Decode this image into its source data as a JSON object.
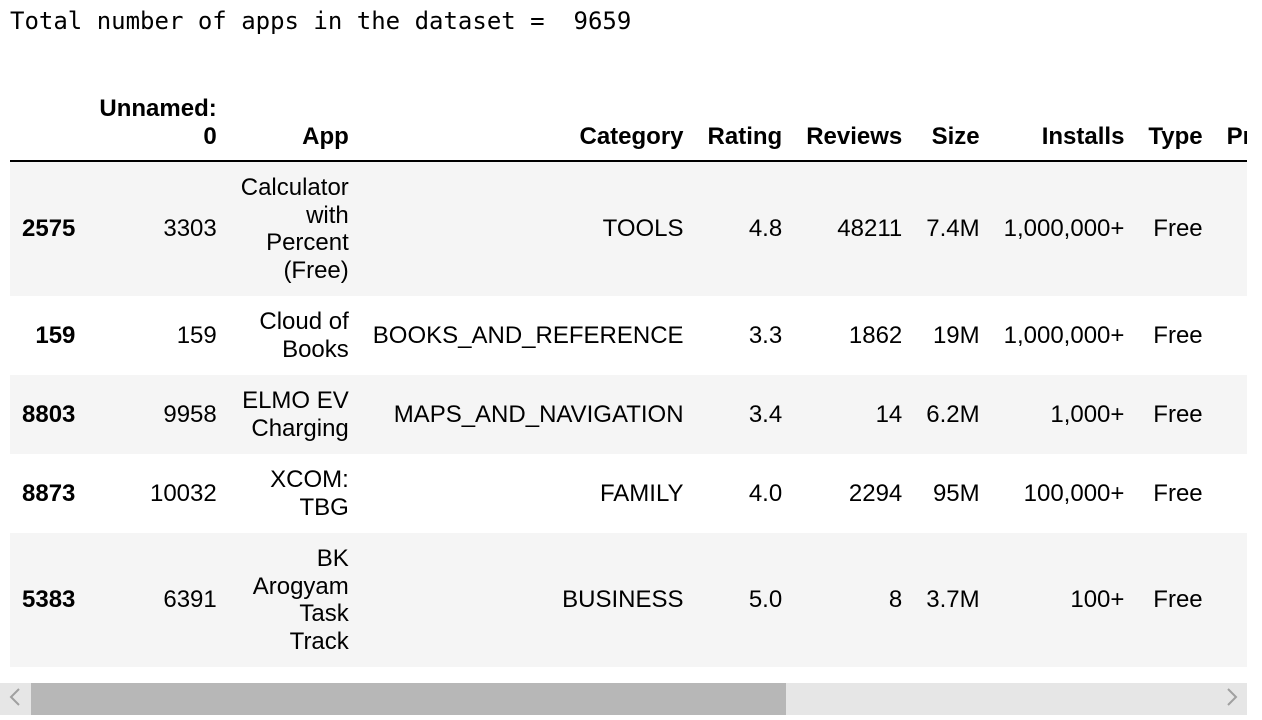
{
  "output": {
    "text": "Total number of apps in the dataset =  9659"
  },
  "table": {
    "columns": [
      "",
      "Unnamed: 0",
      "App",
      "Category",
      "Rating",
      "Reviews",
      "Size",
      "Installs",
      "Type",
      "Pr"
    ],
    "rows": [
      {
        "index": "2575",
        "unnamed": "3303",
        "app": "Calculator with Percent (Free)",
        "category": "TOOLS",
        "rating": "4.8",
        "reviews": "48211",
        "size": "7.4M",
        "installs": "1,000,000+",
        "type": "Free"
      },
      {
        "index": "159",
        "unnamed": "159",
        "app": "Cloud of Books",
        "category": "BOOKS_AND_REFERENCE",
        "rating": "3.3",
        "reviews": "1862",
        "size": "19M",
        "installs": "1,000,000+",
        "type": "Free"
      },
      {
        "index": "8803",
        "unnamed": "9958",
        "app": "ELMO EV Charging",
        "category": "MAPS_AND_NAVIGATION",
        "rating": "3.4",
        "reviews": "14",
        "size": "6.2M",
        "installs": "1,000+",
        "type": "Free"
      },
      {
        "index": "8873",
        "unnamed": "10032",
        "app": "XCOM: TBG",
        "category": "FAMILY",
        "rating": "4.0",
        "reviews": "2294",
        "size": "95M",
        "installs": "100,000+",
        "type": "Free"
      },
      {
        "index": "5383",
        "unnamed": "6391",
        "app": "BK Arogyam Task Track",
        "category": "BUSINESS",
        "rating": "5.0",
        "reviews": "8",
        "size": "3.7M",
        "installs": "100+",
        "type": "Free"
      }
    ]
  },
  "scrollbar": {
    "left_icon": "chevron-left-icon",
    "right_icon": "chevron-right-icon",
    "colors": {
      "track": "#e6e6e6",
      "thumb": "#b7b7b7",
      "arrow": "#a0a0a0"
    }
  }
}
